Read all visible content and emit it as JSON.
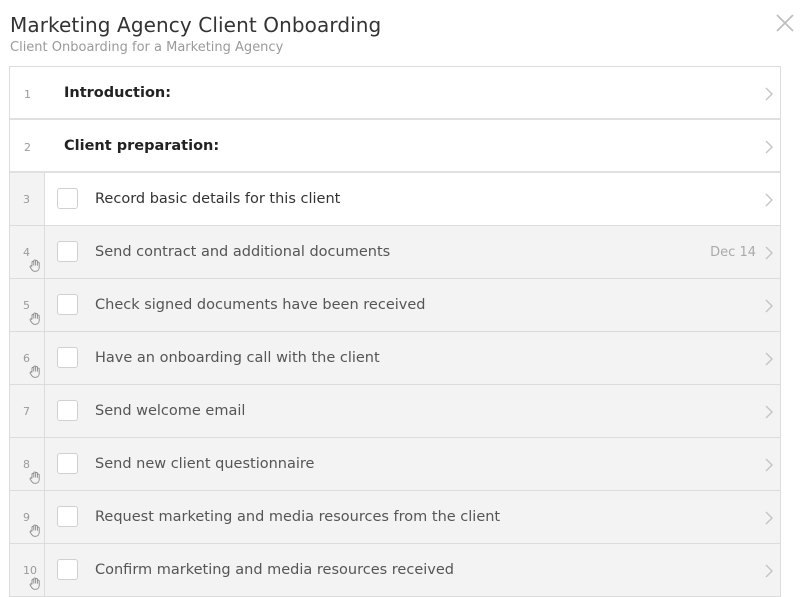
{
  "header": {
    "title": "Marketing Agency Client Onboarding",
    "subtitle": "Client Onboarding for a Marketing Agency"
  },
  "colors": {
    "border": "#dcdcdc",
    "row_bg": "#f3f3f3",
    "active_bg": "#ffffff"
  },
  "rows": [
    {
      "num": "1",
      "type": "heading",
      "label": "Introduction:"
    },
    {
      "num": "2",
      "type": "heading",
      "label": "Client preparation:"
    },
    {
      "num": "3",
      "type": "task",
      "label": "Record basic details for this client",
      "active": true,
      "drag_icon": false
    },
    {
      "num": "4",
      "type": "task",
      "label": "Send contract and additional documents",
      "due": "Dec 14",
      "drag_icon": true
    },
    {
      "num": "5",
      "type": "task",
      "label": "Check signed documents have been received",
      "drag_icon": true
    },
    {
      "num": "6",
      "type": "task",
      "label": "Have an onboarding call with the client",
      "drag_icon": true
    },
    {
      "num": "7",
      "type": "task",
      "label": "Send welcome email",
      "drag_icon": false
    },
    {
      "num": "8",
      "type": "task",
      "label": "Send new client questionnaire",
      "drag_icon": true
    },
    {
      "num": "9",
      "type": "task",
      "label": "Request marketing and media resources from the client",
      "drag_icon": true
    },
    {
      "num": "10",
      "type": "task",
      "label": "Confirm marketing and media resources received",
      "drag_icon": true
    }
  ]
}
